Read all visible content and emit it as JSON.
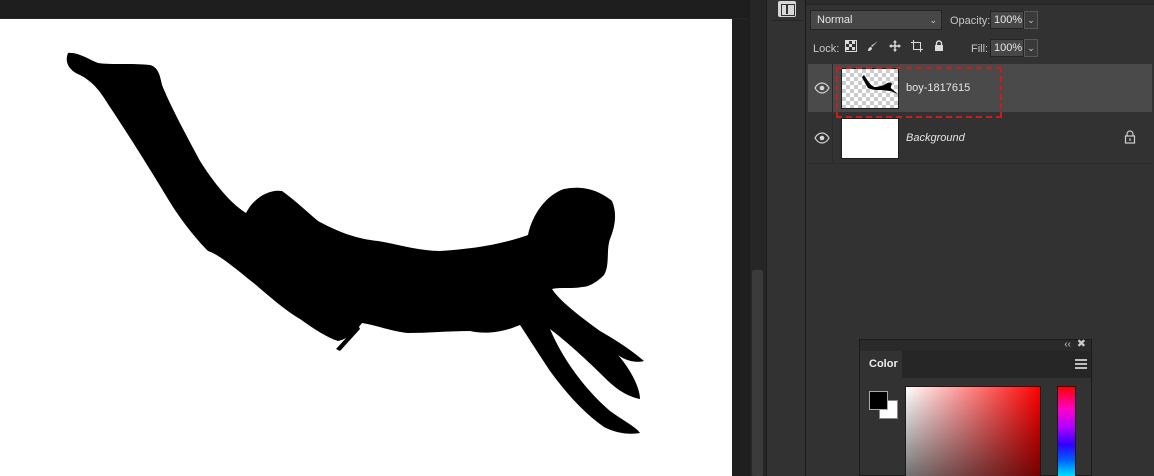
{
  "layers_panel": {
    "blend_mode": "Normal",
    "opacity_label": "Opacity:",
    "opacity_value": "100%",
    "lock_label": "Lock:",
    "fill_label": "Fill:",
    "fill_value": "100%",
    "layers": [
      {
        "name": "boy-1817615",
        "visible": true,
        "selected": true
      },
      {
        "name": "Background",
        "visible": true,
        "locked": true
      }
    ]
  },
  "color_panel": {
    "tab_label": "Color",
    "foreground_color": "#000000",
    "background_color": "#ffffff"
  },
  "colors": {
    "highlight_annotation": "#cc1b1b",
    "canvas_background": "#ffffff",
    "ui_background": "#323232"
  },
  "icons": {
    "eye": "eye-icon",
    "lock": "lock-icon",
    "collapse": "double-chevron-left-icon",
    "close": "close-icon",
    "panel_menu": "hamburger-menu-icon"
  }
}
